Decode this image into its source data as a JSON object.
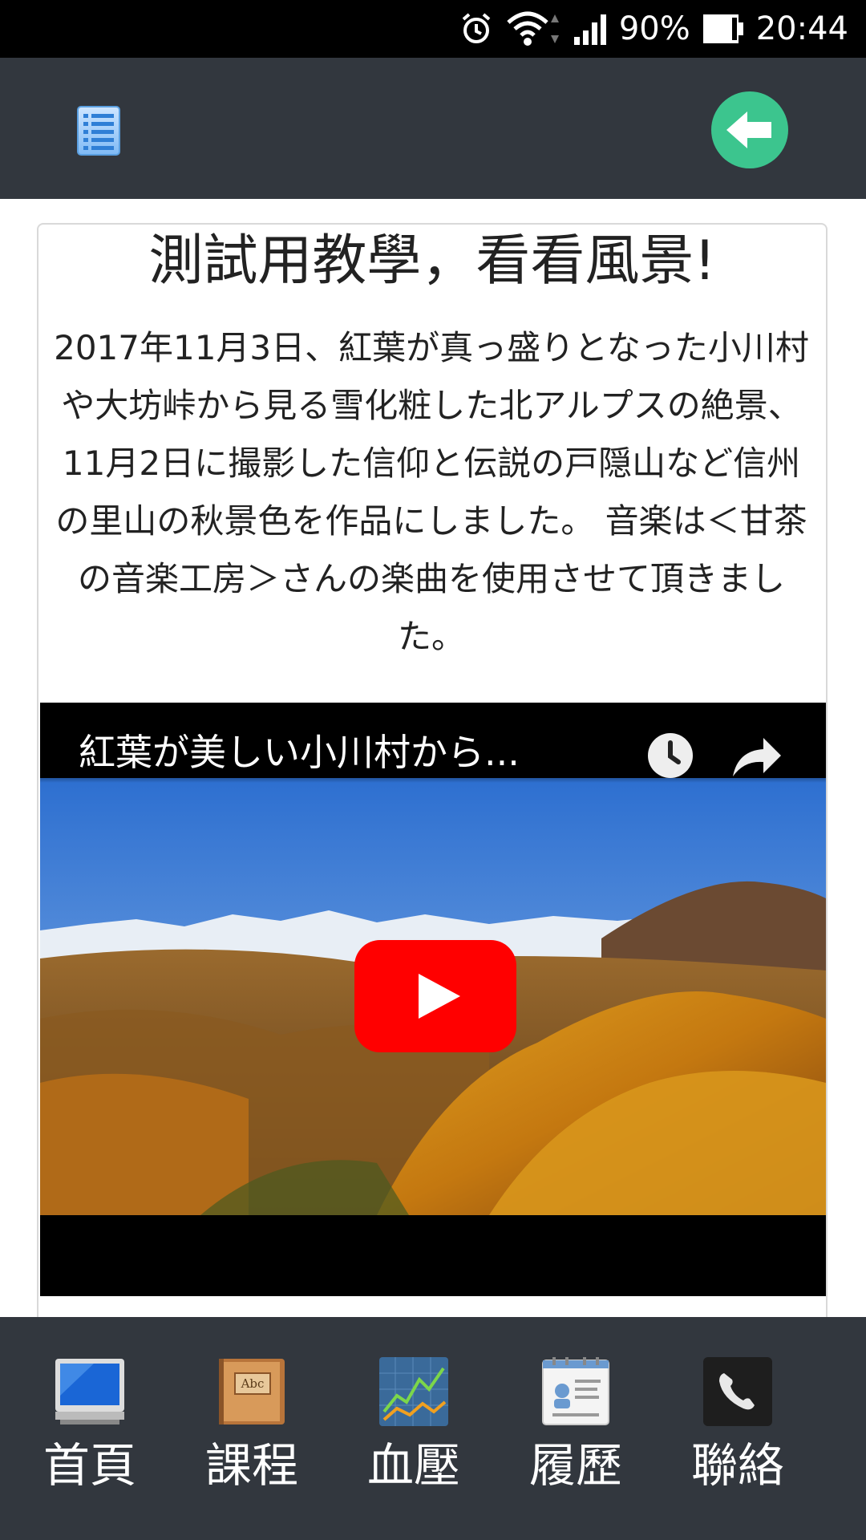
{
  "status_bar": {
    "battery": "90%",
    "time": "20:44",
    "icons": [
      "alarm-icon",
      "wifi-icon",
      "signal-icon",
      "battery-icon"
    ]
  },
  "header": {
    "menu_icon": "list-icon",
    "back_icon": "back-arrow-icon",
    "back_color": "#3cc58e"
  },
  "article": {
    "title": "測試用教學，看看風景!",
    "description": "2017年11月3日、紅葉が真っ盛りとなった小川村や大坊峠から見る雪化粧した北アルプスの絶景、 11月2日に撮影した信仰と伝説の戸隠山など信州の里山の秋景色を作品にしました。 音楽は＜甘茶の音楽工房＞さんの楽曲を使用させて頂きました。"
  },
  "video": {
    "title": "紅葉が美しい小川村から...",
    "icons": [
      "watch-later-icon",
      "share-icon",
      "youtube-play-icon"
    ],
    "play_color": "#ff0000"
  },
  "bottom_nav": {
    "items": [
      {
        "label": "首頁",
        "icon": "monitor-icon"
      },
      {
        "label": "課程",
        "icon": "book-icon"
      },
      {
        "label": "血壓",
        "icon": "chart-icon"
      },
      {
        "label": "履歷",
        "icon": "contact-card-icon"
      },
      {
        "label": "聯絡",
        "icon": "phone-icon"
      }
    ]
  },
  "colors": {
    "header_bg": "#32373e",
    "status_bg": "#000000"
  }
}
